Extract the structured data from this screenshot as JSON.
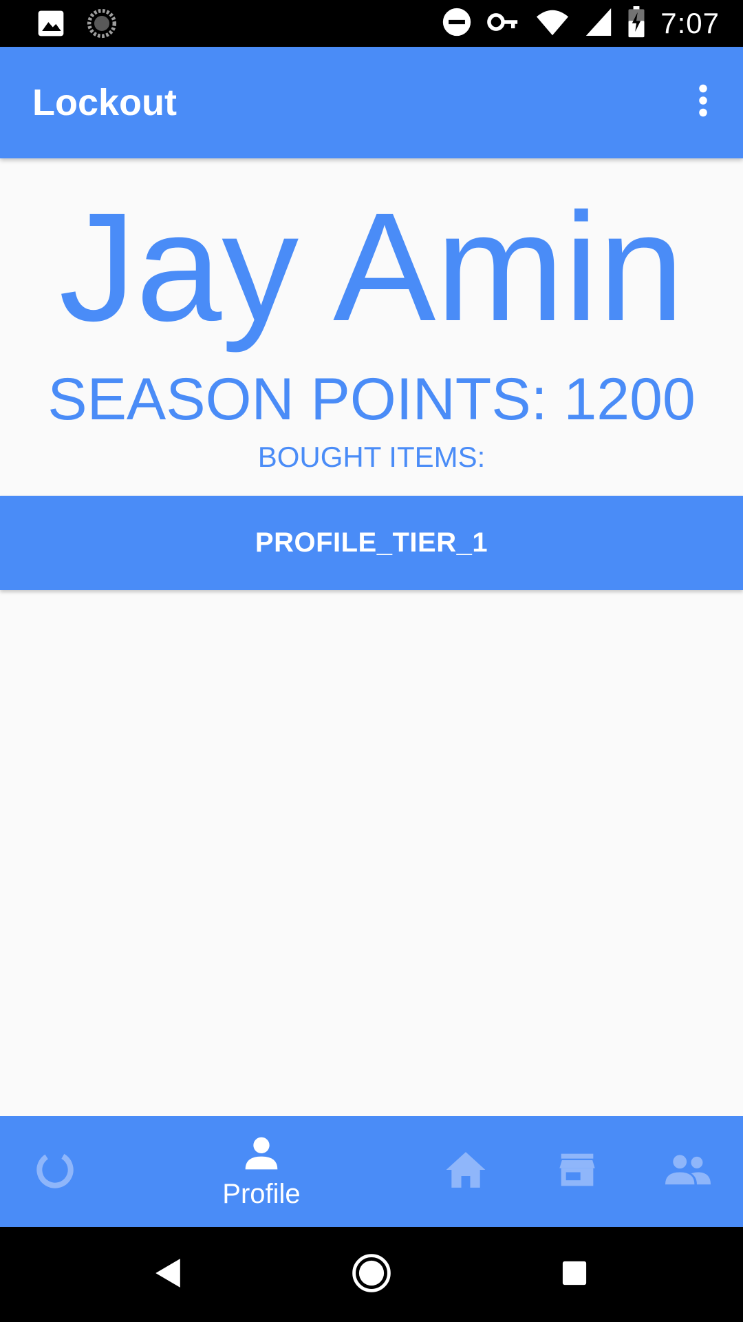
{
  "status_bar": {
    "time": "7:07",
    "left_icons": [
      "gallery-icon",
      "loading-icon"
    ],
    "right_icons": [
      "dnd-icon",
      "vpn-key-icon",
      "wifi-icon",
      "signal-icon",
      "battery-charging-icon"
    ]
  },
  "app_bar": {
    "title": "Lockout",
    "menu_icon": "more-vert-icon"
  },
  "profile": {
    "name": "Jay Amin",
    "season_points": "SEASON POINTS: 1200",
    "bought_items_label": "BOUGHT ITEMS:",
    "items": [
      "PROFILE_TIER_1"
    ]
  },
  "bottom_nav": {
    "items": [
      {
        "icon": "progress-icon",
        "label": ""
      },
      {
        "icon": "person-icon",
        "label": "Profile",
        "selected": true
      },
      {
        "icon": "home-icon",
        "label": ""
      },
      {
        "icon": "store-icon",
        "label": ""
      },
      {
        "icon": "group-icon",
        "label": ""
      }
    ]
  },
  "system_nav": {
    "buttons": [
      "back-icon",
      "home-circle-icon",
      "recents-icon"
    ]
  },
  "colors": {
    "accent": "#4a8cf7",
    "background": "#fafafa",
    "inactive_icon": "#8fb6fa",
    "bar": "#000000"
  }
}
